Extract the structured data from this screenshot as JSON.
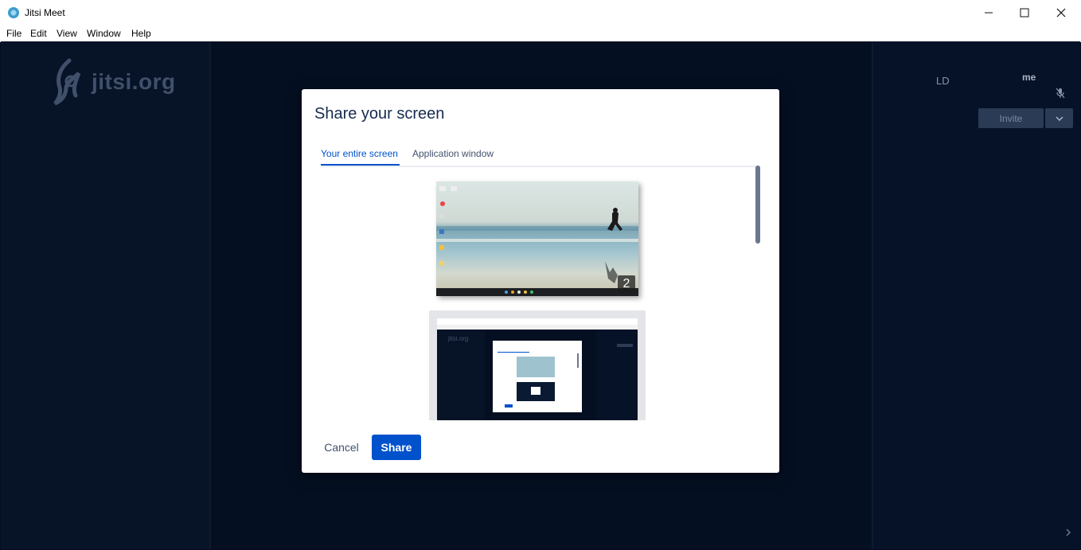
{
  "window": {
    "title": "Jitsi Meet",
    "controls": {
      "minimize": "─",
      "maximize": "☐",
      "close": "✕"
    }
  },
  "menu": [
    "File",
    "Edit",
    "View",
    "Window",
    "Help"
  ],
  "app": {
    "logo_text": "jitsi.org",
    "participant_initials": "LD",
    "self_label": "me",
    "invite_label": "Invite",
    "icons": [
      "mic-muted-icon",
      "chevron-down-icon",
      "chevron-right-icon"
    ]
  },
  "dialog": {
    "title": "Share your screen",
    "tabs": [
      {
        "label": "Your entire screen",
        "active": true
      },
      {
        "label": "Application window",
        "active": false
      }
    ],
    "sources": [
      {
        "kind": "screen",
        "badge": "2"
      },
      {
        "kind": "screen"
      }
    ],
    "cancel_label": "Cancel",
    "share_label": "Share"
  },
  "colors": {
    "background": "#040f21",
    "accent": "#0052cc",
    "invite_button": "#2b3a55"
  }
}
